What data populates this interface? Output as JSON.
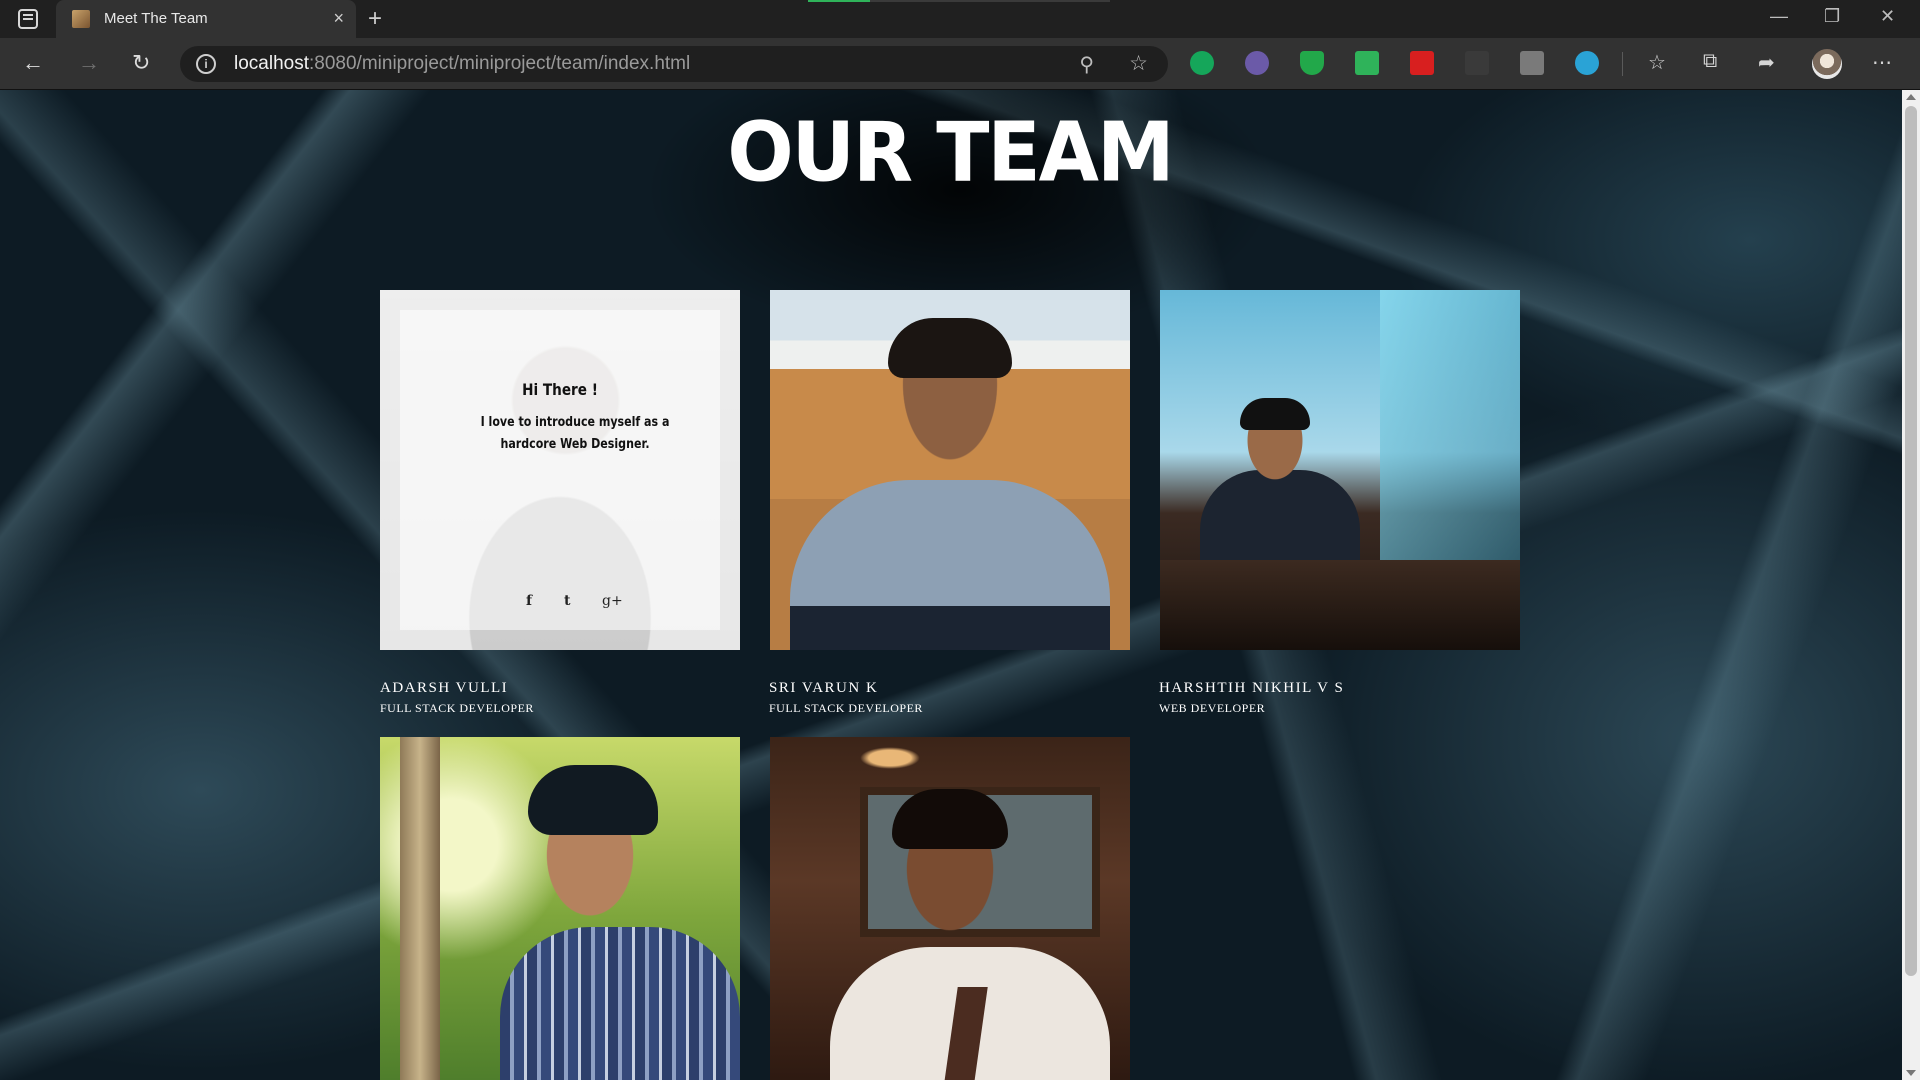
{
  "browser": {
    "tab_title": "Meet The Team",
    "tab_close": "×",
    "new_tab": "+",
    "url_host": "localhost",
    "url_rest": ":8080/miniproject/miniproject/team/index.html",
    "window_controls": [
      "—",
      "❐",
      "✕"
    ]
  },
  "page": {
    "heading": "OUR TEAM",
    "members": [
      {
        "name": "ADARSH VULLI",
        "role": "FULL STACK DEVELOPER",
        "hover": {
          "greeting": "Hi There !",
          "intro": "I love to introduce myself as a hardcore Web Designer.",
          "social": [
            "f",
            "t",
            "g+"
          ]
        }
      },
      {
        "name": "SRI VARUN K",
        "role": "FULL STACK DEVELOPER"
      },
      {
        "name": "HARSHTIH NIKHIL V S",
        "role": "WEB DEVELOPER"
      },
      {
        "name": "",
        "role": ""
      },
      {
        "name": "",
        "role": ""
      }
    ]
  },
  "colors": {
    "accent_green": "#2fb35a",
    "page_bg": "#0d1b24",
    "chrome_dark": "#202020",
    "chrome_bar": "#323232"
  }
}
